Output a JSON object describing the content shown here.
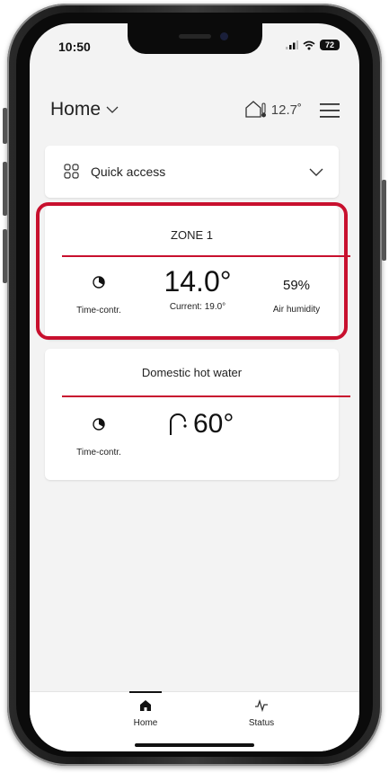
{
  "status_bar": {
    "time": "10:50",
    "battery": "72"
  },
  "header": {
    "title": "Home",
    "outdoor_temp": "12.7˚"
  },
  "quick_access": {
    "label": "Quick access"
  },
  "zone": {
    "title": "ZONE 1",
    "mode_label": "Time-contr.",
    "setpoint": "14.0°",
    "current_label": "Current: 19.0°",
    "humidity": "59%",
    "humidity_label": "Air humidity"
  },
  "dhw": {
    "title": "Domestic hot water",
    "mode_label": "Time-contr.",
    "setpoint": "60°"
  },
  "bottom_nav": {
    "items": [
      {
        "label": "Home",
        "icon": "home-icon"
      },
      {
        "label": "Status",
        "icon": "activity-icon"
      }
    ]
  },
  "colors": {
    "accent": "#c8102e",
    "background": "#f3f3f3"
  }
}
